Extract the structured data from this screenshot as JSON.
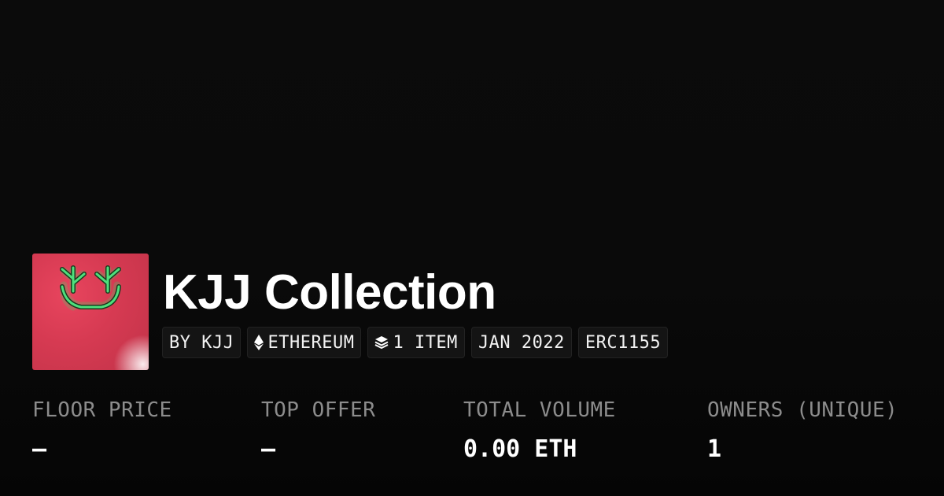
{
  "collection": {
    "title": "KJJ Collection"
  },
  "badges": {
    "creator": "BY KJJ",
    "chain": "ETHEREUM",
    "items": "1 ITEM",
    "date": "JAN 2022",
    "standard": "ERC1155"
  },
  "stats": {
    "floor_price": {
      "label": "FLOOR PRICE",
      "value": "–"
    },
    "top_offer": {
      "label": "TOP OFFER",
      "value": "–"
    },
    "total_volume": {
      "label": "TOTAL VOLUME",
      "value": "0.00 ETH"
    },
    "owners": {
      "label": "OWNERS (UNIQUE)",
      "value": "1"
    }
  },
  "icons": {
    "chain": "ethereum-icon",
    "items": "layers-icon"
  },
  "colors": {
    "background": "#0a0a0a",
    "avatar_background": "#d63a52",
    "antler_stroke": "#39d96b",
    "label_gray": "#8c8c8c"
  }
}
